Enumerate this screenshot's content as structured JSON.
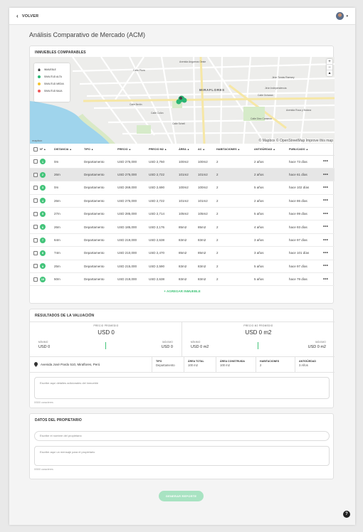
{
  "topbar": {
    "back_label": "VOLVER",
    "user_caret": "▾"
  },
  "page": {
    "title": "Análisis Comparativo de Mercado (ACM)"
  },
  "comparables": {
    "title": "INMUEBLES COMPARABLES",
    "legend": [
      {
        "label": "INMUEBLE",
        "icon": "house-icon",
        "color": "#444444"
      },
      {
        "label": "SIMILITUD ALTA",
        "icon": "dot",
        "color": "#2bb673"
      },
      {
        "label": "SIMILITUD MEDIA",
        "icon": "dot",
        "color": "#f4c430"
      },
      {
        "label": "SIMILITUD BAJA",
        "icon": "dot",
        "color": "#ef5a5a"
      }
    ],
    "map": {
      "attribution": "© Mapbox © OpenStreetMap Improve this map",
      "logo": "mapbox",
      "district": "MIRAFLORES",
      "street_labels": [
        "Calle Alcanfores",
        "Avenida Ricardo Palma",
        "Avenida Arequipa",
        "Calle Porta",
        "Avenida Larco",
        "Avenida José Pardo",
        "Avenida Benavides",
        "Calle Berlín",
        "Calle Colón",
        "Jirón Independencia",
        "Calle Schell",
        "Avenida Roca y Bolona",
        "Avenida Angamos Oeste",
        "Jirón Juan Fanning",
        "Avenida Reducto",
        "Calle Diez Canseco",
        "Calle Ocharan",
        "Calle Piura",
        "Avenida Alfredo Benavides",
        "Calle Tarata",
        "Calle Bolognesi",
        "Jirón Tomás Ramsey",
        "Calle Enrique Palacios",
        "Avenida Grau",
        "Avenida Paseo de la República"
      ],
      "zoom_in": "+",
      "zoom_out": "−"
    },
    "columns": [
      "Nº",
      "DISTANCIA",
      "TIPO",
      "PRECIO",
      "PRECIO M2",
      "ÁREA",
      "AC",
      "HABITACIONES",
      "ANTIGÜEDAD",
      "PUBLICADO"
    ],
    "rows": [
      {
        "n": "1",
        "distance": "0m",
        "type": "Departamento",
        "price": "USD 275,000",
        "price_m2": "USD 2,750",
        "area": "100m2",
        "ac": "100m2",
        "rooms": "2",
        "age": "2 años",
        "published": "hace 73 días"
      },
      {
        "n": "2",
        "distance": "26m",
        "type": "Departamento",
        "price": "USD 275,000",
        "price_m2": "USD 2,722",
        "area": "101m2",
        "ac": "101m2",
        "rooms": "2",
        "age": "2 años",
        "published": "hace 61 días"
      },
      {
        "n": "3",
        "distance": "0m",
        "type": "Departamento",
        "price": "USD 269,000",
        "price_m2": "USD 2,690",
        "area": "100m2",
        "ac": "100m2",
        "rooms": "2",
        "age": "5 años",
        "published": "hace 102 días"
      },
      {
        "n": "4",
        "distance": "26m",
        "type": "Departamento",
        "price": "USD 275,000",
        "price_m2": "USD 2,722",
        "area": "101m2",
        "ac": "101m2",
        "rooms": "2",
        "age": "2 años",
        "published": "hace 86 días"
      },
      {
        "n": "5",
        "distance": "27m",
        "type": "Departamento",
        "price": "USD 285,000",
        "price_m2": "USD 2,714",
        "area": "105m2",
        "ac": "105m2",
        "rooms": "2",
        "age": "5 años",
        "published": "hace 99 días"
      },
      {
        "n": "6",
        "distance": "26m",
        "type": "Departamento",
        "price": "USD 185,000",
        "price_m2": "USD 2,176",
        "area": "85m2",
        "ac": "85m2",
        "rooms": "2",
        "age": "4 años",
        "published": "hace 93 días"
      },
      {
        "n": "7",
        "distance": "64m",
        "type": "Departamento",
        "price": "USD 219,000",
        "price_m2": "USD 2,638",
        "area": "83m2",
        "ac": "83m2",
        "rooms": "2",
        "age": "3 años",
        "published": "hace 97 días"
      },
      {
        "n": "8",
        "distance": "74m",
        "type": "Departamento",
        "price": "USD 210,000",
        "price_m2": "USD 2,470",
        "area": "85m2",
        "ac": "85m2",
        "rooms": "2",
        "age": "3 años",
        "published": "hace 101 días"
      },
      {
        "n": "9",
        "distance": "25m",
        "type": "Departamento",
        "price": "USD 215,000",
        "price_m2": "USD 2,590",
        "area": "83m2",
        "ac": "83m2",
        "rooms": "2",
        "age": "5 años",
        "published": "hace 97 días"
      },
      {
        "n": "10",
        "distance": "50m",
        "type": "Departamento",
        "price": "USD 219,000",
        "price_m2": "USD 2,638",
        "area": "83m2",
        "ac": "83m2",
        "rooms": "2",
        "age": "5 años",
        "published": "hace 79 días"
      }
    ],
    "selected_row": "2",
    "add_label": "+ AGREGAR INMUEBLE"
  },
  "valuation": {
    "title": "RESULTADOS DE LA VALUACIÓN",
    "avg_price": {
      "label": "PRECIO PROMEDIO",
      "value": "USD 0",
      "min_label": "MÍNIMO",
      "min": "USD 0",
      "max_label": "MÁXIMO",
      "max": "USD 0"
    },
    "avg_price_m2": {
      "label": "PRECIO M2 PROMEDIO",
      "value": "USD 0 m2",
      "min_label": "MÍNIMO",
      "min": "USD 0 m2",
      "max_label": "MÁXIMO",
      "max": "USD 0 m2"
    },
    "address": "Avenida José Pardo 510, Miraflores, Perú",
    "attributes": [
      {
        "k": "TIPO",
        "v": "Departamento"
      },
      {
        "k": "ÁREA TOTAL",
        "v": "100 m2"
      },
      {
        "k": "ÁREA CONSTRUIDA",
        "v": "100 m2"
      },
      {
        "k": "HABITACIONES",
        "v": "2"
      },
      {
        "k": "ANTIGÜEDAD",
        "v": "3 Años"
      }
    ],
    "details_placeholder": "Escribe aquí detalles adicionales del inmueble",
    "details_counter": "0/500 caracteres"
  },
  "owner": {
    "title": "DATOS DEL PROPIETARIO",
    "name_placeholder": "Escribe el nombre del propietario",
    "message_placeholder": "Escribe aquí un mensaje para el propietario",
    "message_counter": "0/500 caracteres"
  },
  "actions": {
    "generate_label": "GENERAR REPORTE",
    "help_label": "?"
  },
  "colors": {
    "accent": "#43c47a",
    "accent_disabled": "#a8e3c2"
  }
}
